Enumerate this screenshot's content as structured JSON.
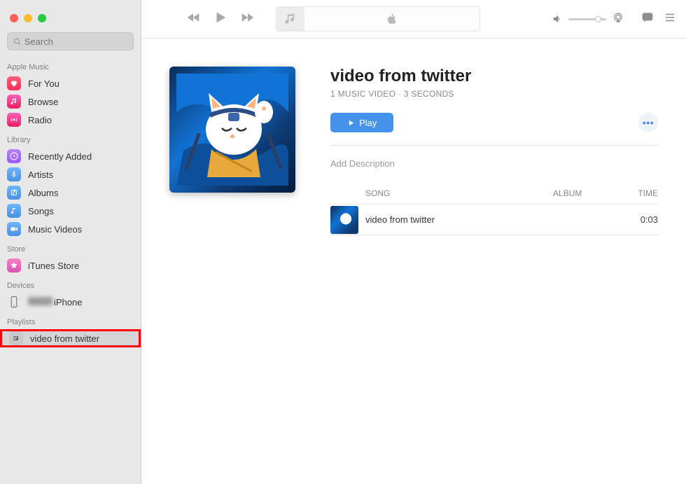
{
  "search": {
    "placeholder": "Search"
  },
  "sidebar": {
    "apple_music_header": "Apple Music",
    "apple_music": [
      {
        "label": "For You",
        "icon": "heart"
      },
      {
        "label": "Browse",
        "icon": "music"
      },
      {
        "label": "Radio",
        "icon": "radio"
      }
    ],
    "library_header": "Library",
    "library": [
      {
        "label": "Recently Added",
        "icon": "clock"
      },
      {
        "label": "Artists",
        "icon": "mic"
      },
      {
        "label": "Albums",
        "icon": "album"
      },
      {
        "label": "Songs",
        "icon": "note"
      },
      {
        "label": "Music Videos",
        "icon": "video"
      }
    ],
    "store_header": "Store",
    "store": [
      {
        "label": "iTunes Store",
        "icon": "star"
      }
    ],
    "devices_header": "Devices",
    "devices": [
      {
        "label": "iPhone",
        "icon": "phone"
      }
    ],
    "playlists_header": "Playlists",
    "playlists": [
      {
        "label": "video from twitter",
        "icon": "playlist"
      }
    ]
  },
  "content": {
    "title": "video from twitter",
    "subtitle": "1 MUSIC VIDEO · 3 SECONDS",
    "play_label": "Play",
    "description_placeholder": "Add Description",
    "columns": {
      "song": "SONG",
      "album": "ALBUM",
      "time": "TIME"
    },
    "tracks": [
      {
        "title": "video from twitter",
        "album": "",
        "time": "0:03"
      }
    ]
  }
}
